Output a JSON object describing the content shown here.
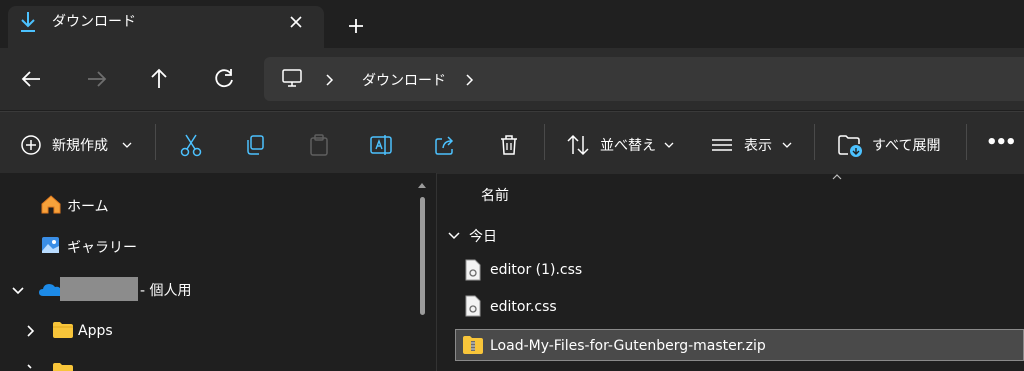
{
  "tab": {
    "title": "ダウンロード",
    "icon": "download-icon"
  },
  "address": {
    "segment": "ダウンロード",
    "icon": "computer-icon"
  },
  "toolbar": {
    "new_label": "新規作成",
    "sort_label": "並べ替え",
    "view_label": "表示",
    "extract_label": "すべて展開",
    "more": "•••"
  },
  "sidebar": {
    "home": "ホーム",
    "gallery": "ギャラリー",
    "onedrive_suffix": "- 個人用",
    "apps": "Apps"
  },
  "main": {
    "column_name": "名前",
    "group_today": "今日",
    "files": [
      "editor (1).css",
      "editor.css",
      "Load-My-Files-for-Gutenberg-master.zip"
    ]
  },
  "colors": {
    "accent": "#4cc2ff",
    "folder": "#f8c53a"
  }
}
